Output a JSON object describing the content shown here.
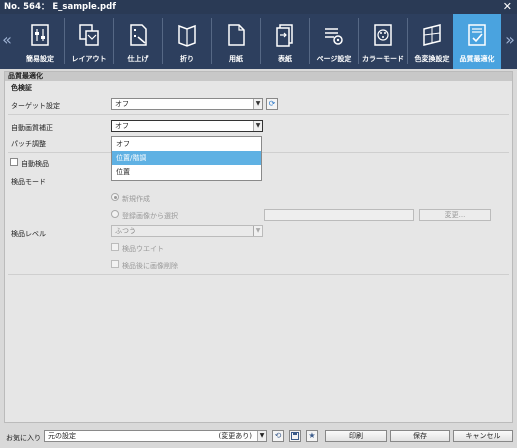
{
  "window": {
    "title": "No. 564： E_sample.pdf",
    "close": "✕"
  },
  "toolbar": {
    "left_arrow": "«",
    "right_arrow": "»",
    "tools": [
      {
        "label": "簡易設定"
      },
      {
        "label": "レイアウト"
      },
      {
        "label": "仕上げ"
      },
      {
        "label": "折り"
      },
      {
        "label": "用紙"
      },
      {
        "label": "表紙"
      },
      {
        "label": "ページ設定"
      },
      {
        "label": "カラーモード"
      },
      {
        "label": "色変換設定"
      },
      {
        "label": "品質最適化",
        "active": true
      }
    ],
    "active_color": "#4aa3df"
  },
  "main": {
    "section_title": "品質最適化",
    "subsection_title": "色検証",
    "target_setting": {
      "label": "ターゲット設定",
      "value": "オフ"
    },
    "auto_correction": {
      "label": "自動画質補正",
      "value": "オフ"
    },
    "patch_adjust": {
      "label": "パッチ調整"
    },
    "dropdown_options": [
      "オフ",
      "位置/階調",
      "位置"
    ],
    "dropdown_selected_index": 1,
    "auto_inspect": {
      "label": "自動検品",
      "checked": false
    },
    "inspect_mode": {
      "label": "検品モード",
      "radio_new": "新規作成",
      "radio_registered": "登録画像から選択",
      "change_button": "変更..."
    },
    "inspect_level": {
      "label": "検品レベル",
      "value": "ふつう",
      "check_wait": "検品ウエイト",
      "check_delete": "検品後に画像削除"
    }
  },
  "footer": {
    "favorites_label": "お気に入り",
    "favorites_value": "元の設定",
    "favorites_note": "(変更あり)",
    "print_button": "印刷",
    "save_button": "保存",
    "cancel_button": "キャンセル"
  }
}
